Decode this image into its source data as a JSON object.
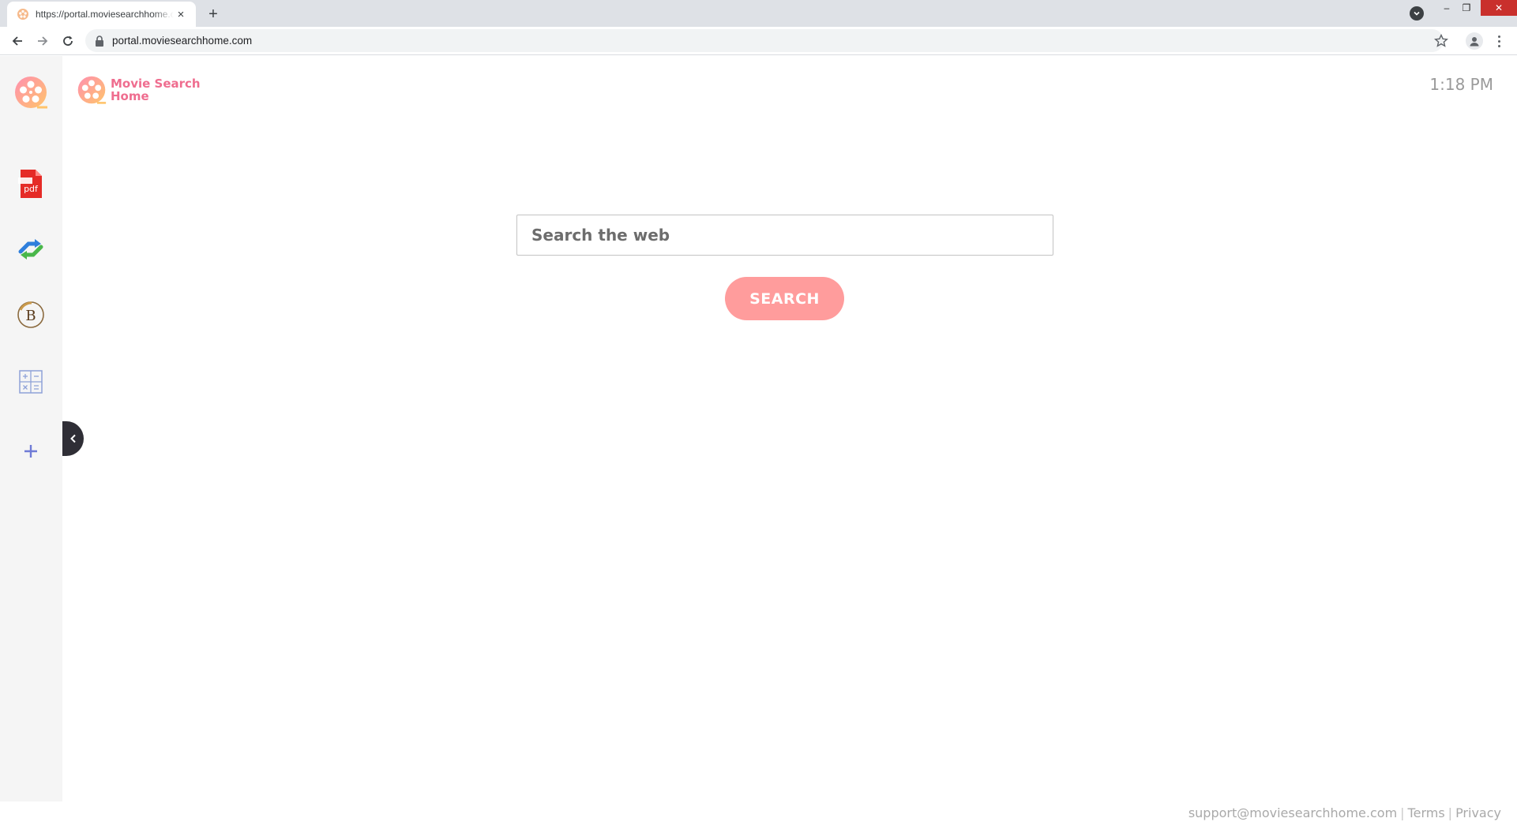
{
  "browser": {
    "tab": {
      "title": "https://portal.moviesearchhome.com",
      "close_label": "×"
    },
    "new_tab_label": "+",
    "window_controls": {
      "minimize": "–",
      "restore": "❐",
      "close": "✕"
    },
    "address_bar": {
      "url": "portal.moviesearchhome.com"
    },
    "icons": [
      "back-arrow-icon",
      "forward-arrow-icon",
      "reload-icon",
      "lock-icon",
      "star-icon",
      "profile-icon",
      "kebab-menu-icon",
      "tab-search-icon"
    ]
  },
  "sidebar": {
    "items": [
      {
        "name": "movie-reel-logo",
        "icon": "film-reel-icon"
      },
      {
        "name": "pdf-app",
        "icon": "pdf-icon",
        "label": "pdf"
      },
      {
        "name": "converter-app",
        "icon": "arrows-convert-icon"
      },
      {
        "name": "bitcoin-app",
        "icon": "bitcoin-icon",
        "label": "B"
      },
      {
        "name": "calculator-app",
        "icon": "calculator-icon"
      },
      {
        "name": "add-app",
        "icon": "plus-icon",
        "label": "+"
      }
    ],
    "collapse_label": "‹"
  },
  "brand": {
    "name": "Movie Search Home",
    "logo_icon": "film-reel-icon"
  },
  "clock": {
    "time": "1:18 PM"
  },
  "search": {
    "placeholder": "Search the web",
    "button_label": "SEARCH"
  },
  "footer": {
    "email": "support@moviesearchhome.com",
    "separator": "|",
    "terms": "Terms",
    "privacy": "Privacy"
  },
  "colors": {
    "brand_pink": "#ef6d8f",
    "search_button": "#ff9c9c",
    "sidebar_bg": "#f5f5f5",
    "collapse_btn": "#2f2e36"
  }
}
